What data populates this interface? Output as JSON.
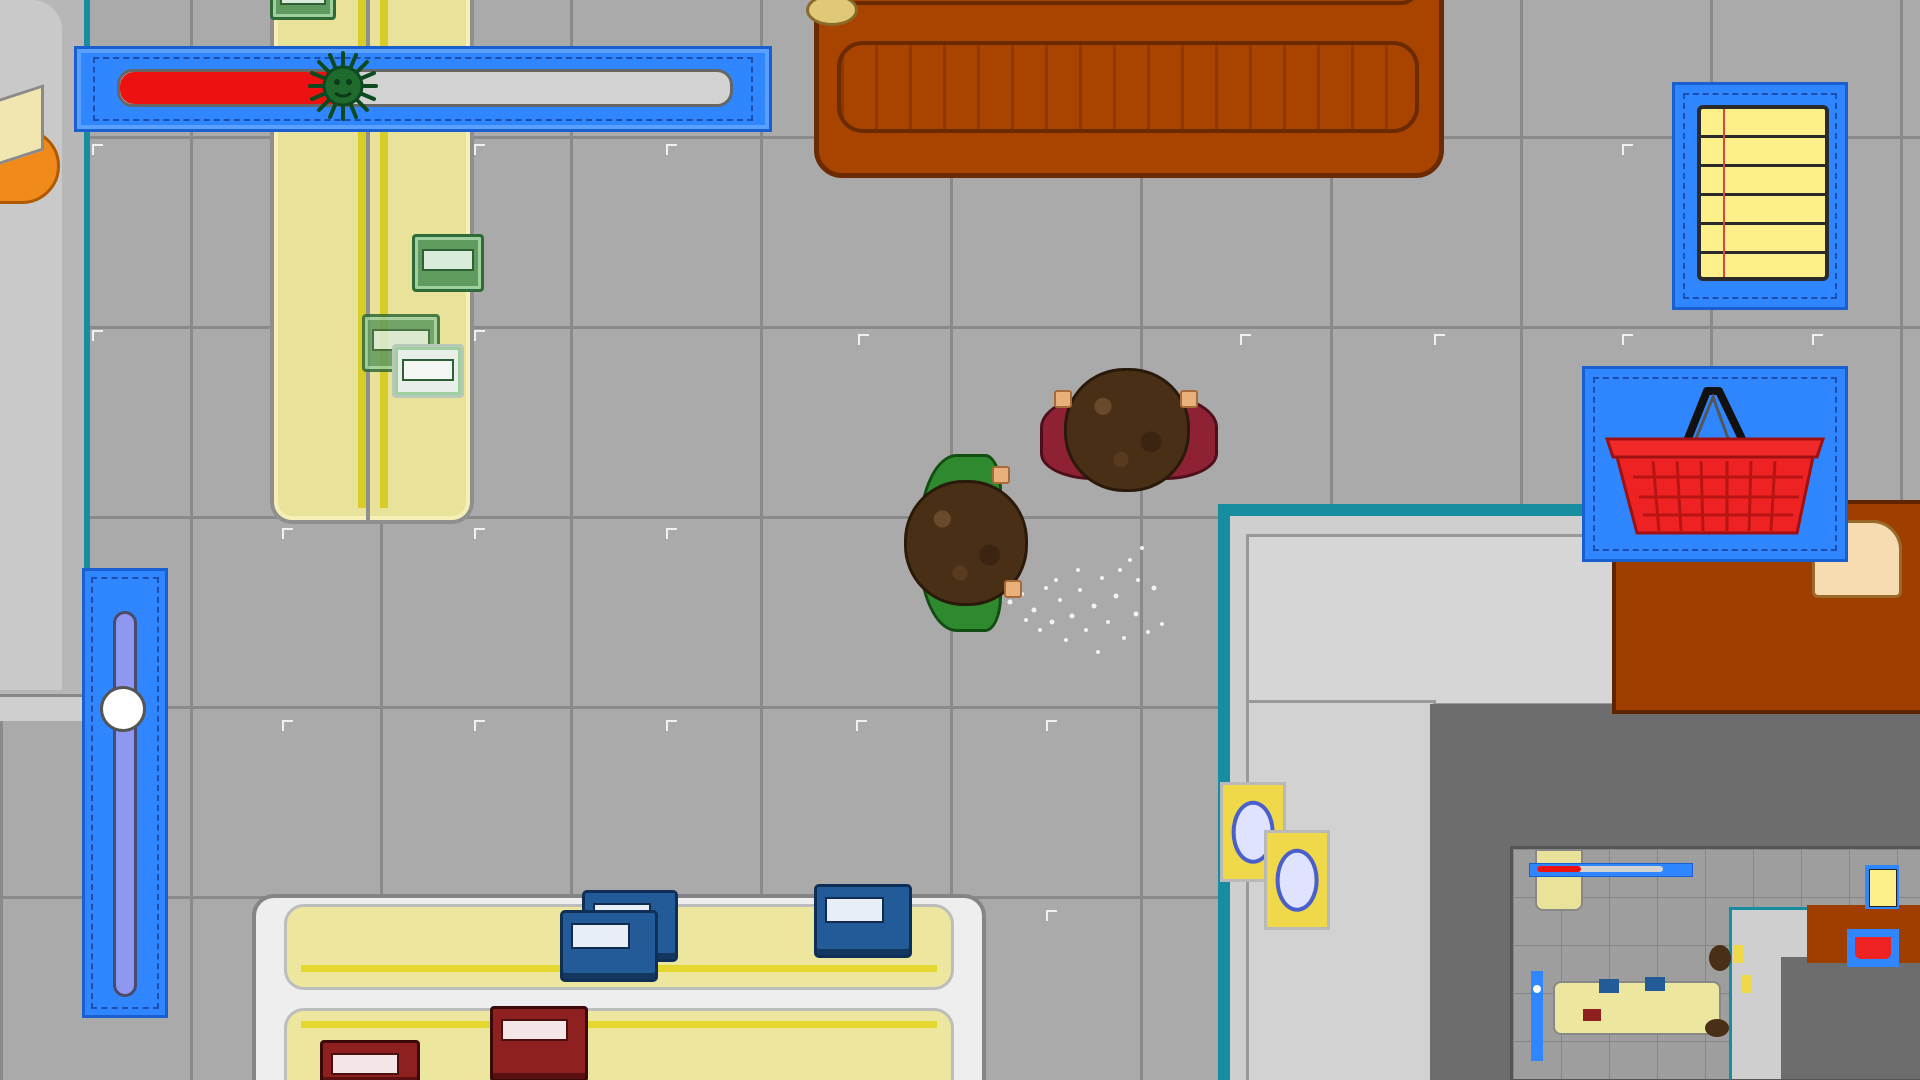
{
  "screen": {
    "type": "top-down supermarket game view"
  },
  "hud": {
    "infection_meter": {
      "level": 0.37,
      "fill_color": "#ee1111",
      "track_color": "#d2d2d2",
      "panel_color": "#2f86ff",
      "icon": "virus-icon"
    },
    "shopping_list_button": {
      "icon": "notepad-icon",
      "panel_color": "#2f86ff"
    },
    "basket_button": {
      "icon": "shopping-basket-icon",
      "panel_color": "#2f86ff",
      "basket_color": "#ee2a2a"
    },
    "zoom_slider": {
      "level": 0.78,
      "knob_color": "#ffffff",
      "track_color": "#8e98f0"
    },
    "minimap": {
      "icon": "minimap"
    }
  },
  "colors": {
    "wall_accent": "#178da0",
    "shelf_yellow": "#e9e29a",
    "bench_wood": "#a84300",
    "player_shirt": "#2f8a2f",
    "shopper_shirt": "#8f2134"
  },
  "entities": {
    "player": {
      "icon": "player-character"
    },
    "shopper": {
      "icon": "npc-shopper"
    },
    "sneeze": {
      "icon": "sneeze-particles"
    }
  }
}
